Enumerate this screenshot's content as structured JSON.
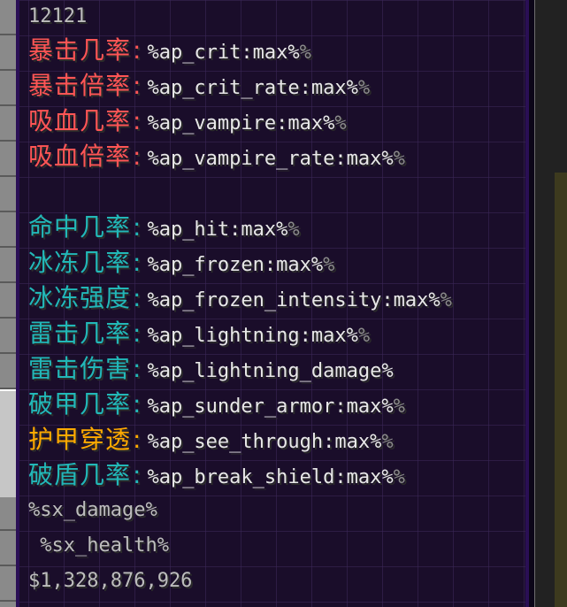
{
  "tooltip": {
    "header": "12121",
    "stats": [
      {
        "label": "暴击几率",
        "sep": ":",
        "value": "%ap_crit:max%",
        "tail": "%",
        "color": "#ff5555"
      },
      {
        "label": "暴击倍率",
        "sep": ":",
        "value": "%ap_crit_rate:max%",
        "tail": "%",
        "color": "#ff5555"
      },
      {
        "label": "吸血几率",
        "sep": ":",
        "value": "%ap_vampire:max%",
        "tail": "%",
        "color": "#ff5555"
      },
      {
        "label": "吸血倍率",
        "sep": ":",
        "value": "%ap_vampire_rate:max%",
        "tail": "%",
        "color": "#ff5555"
      },
      {
        "label": "命中几率",
        "sep": ":",
        "value": "%ap_hit:max%",
        "tail": "%",
        "color": "#22b8b8"
      },
      {
        "label": "冰冻几率",
        "sep": ":",
        "value": "%ap_frozen:max%",
        "tail": "%",
        "color": "#22b8b8"
      },
      {
        "label": "冰冻强度",
        "sep": ":",
        "value": "%ap_frozen_intensity:max%",
        "tail": "%",
        "color": "#22b8b8"
      },
      {
        "label": "雷击几率",
        "sep": ":",
        "value": "%ap_lightning:max%",
        "tail": "%",
        "color": "#22b8b8"
      },
      {
        "label": "雷击伤害",
        "sep": ":",
        "value": "%ap_lightning_damage%",
        "tail": "",
        "color": "#22b8b8"
      },
      {
        "label": "破甲几率",
        "sep": ":",
        "value": "%ap_sunder_armor:max%",
        "tail": "%",
        "color": "#22b8b8"
      },
      {
        "label": "护甲穿透",
        "sep": ":",
        "value": "%ap_see_through:max%",
        "tail": "%",
        "color": "#ffaa00"
      },
      {
        "label": "破盾几率",
        "sep": ":",
        "value": "%ap_break_shield:max%",
        "tail": "%",
        "color": "#22b8b8"
      }
    ],
    "footer": {
      "damage": "%sx_damage%",
      "health": " %sx_health%",
      "price": "$1,328,876,926"
    }
  },
  "colors": {
    "panel_bg": "#1a0d2a",
    "panel_border": "#2a0f55",
    "red": "#ff5555",
    "cyan": "#22b8b8",
    "gold": "#ffaa00",
    "value": "#e8e8e8",
    "muted": "#bdbdbd"
  }
}
